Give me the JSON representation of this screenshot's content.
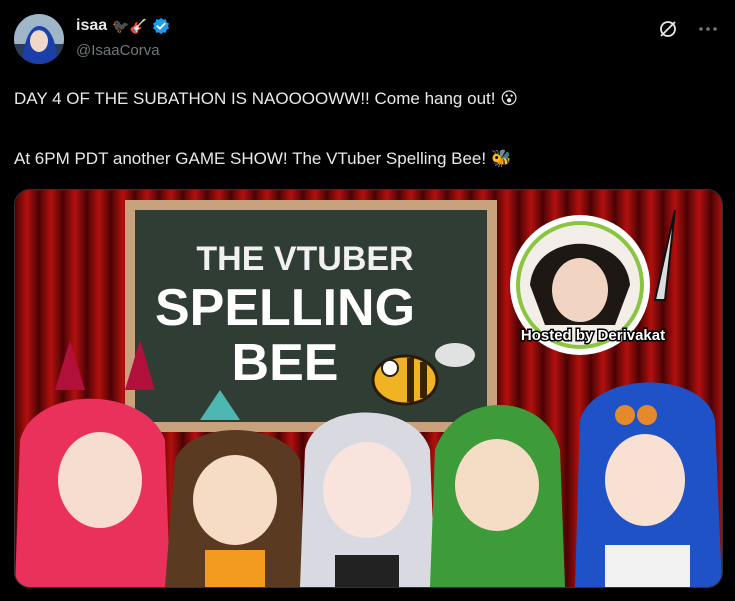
{
  "author": {
    "display_name": "isaa",
    "name_emojis": "🐦‍⬛🎸",
    "handle": "@IsaaCorva",
    "verified": true
  },
  "icons": {
    "grok": "grok-slash-icon",
    "more": "more-dots-icon"
  },
  "tweet": {
    "line1": "DAY 4 OF THE SUBATHON IS NAOOOOWW!! Come hang out! 😮",
    "line2": "At 6PM PDT another GAME SHOW! The VTuber Spelling Bee! 🐝"
  },
  "media": {
    "board_title_line1": "THE VTUBER",
    "board_title_line2": "SPELLING",
    "board_title_line3": "BEE",
    "host_caption": "Hosted by Derivakat"
  },
  "colors": {
    "background": "#000000",
    "text": "#e7e9ea",
    "muted": "#71767b",
    "verified": "#1d9bf0",
    "curtain": "#8b0a0a",
    "board": "#2f3d35"
  }
}
